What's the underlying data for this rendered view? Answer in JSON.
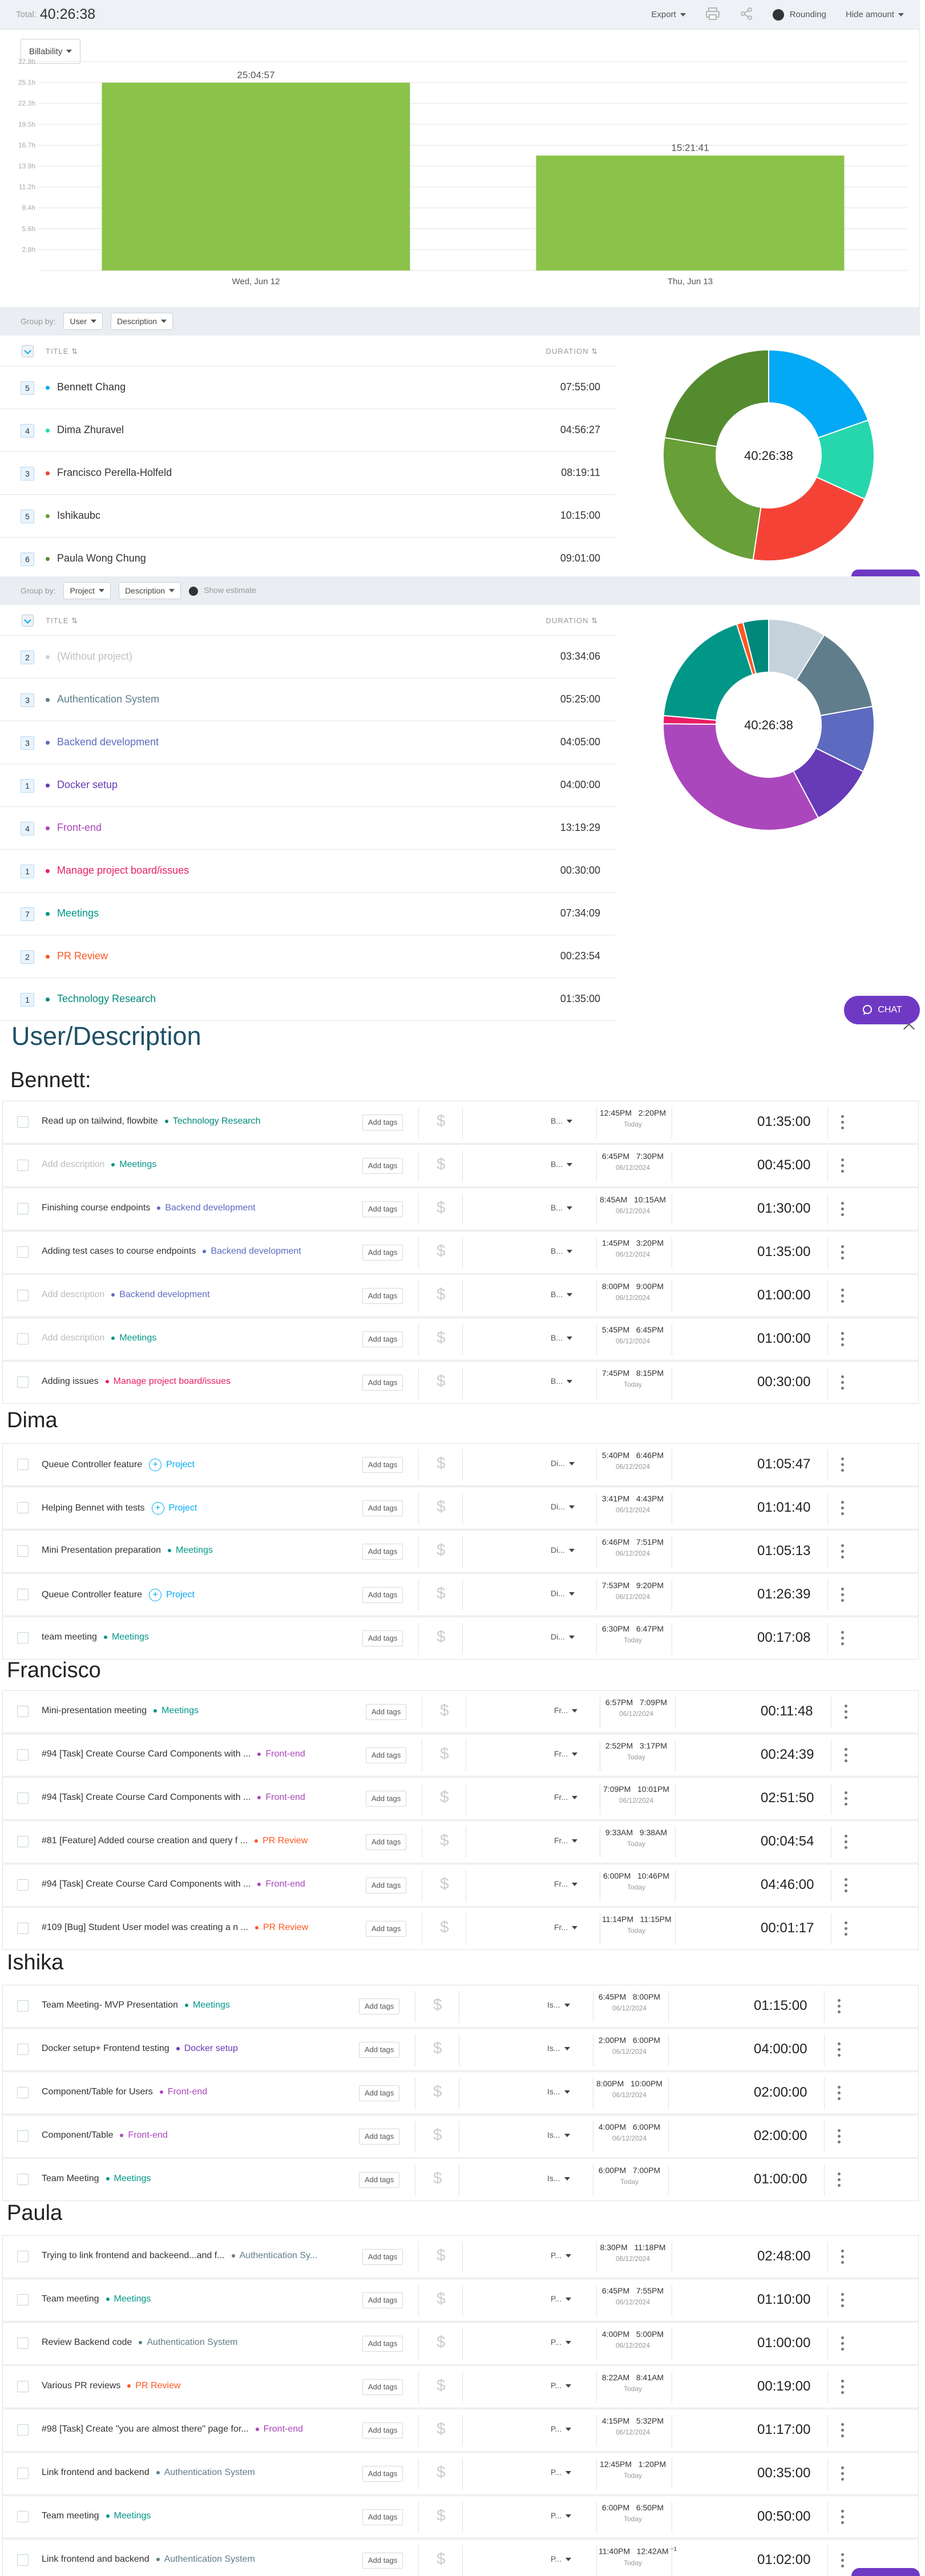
{
  "topbar": {
    "total_label": "Total:",
    "total_value": "40:26:38",
    "export_label": "Export",
    "rounding_label": "Rounding",
    "hide_amount_label": "Hide amount"
  },
  "billability_label": "Billability",
  "chart_data": {
    "type": "bar",
    "categories": [
      "Wed, Jun 12",
      "Thu, Jun 13"
    ],
    "values": [
      25.0825,
      15.3558
    ],
    "data_labels": [
      "25:04:57",
      "15:21:41"
    ],
    "yticks": [
      "27.9h",
      "25.1h",
      "22.3h",
      "19.5h",
      "16.7h",
      "13.9h",
      "11.2h",
      "8.4h",
      "5.6h",
      "2.8h"
    ],
    "ylim": [
      0,
      27.9
    ],
    "grid": true,
    "bar_color": "#8bc34a"
  },
  "groupby1": {
    "label": "Group by:",
    "dd1": "User",
    "dd2": "Description"
  },
  "groupby2": {
    "label": "Group by:",
    "dd1": "Project",
    "dd2": "Description",
    "show_estimate": "Show estimate"
  },
  "table_headers": {
    "title": "TITLE",
    "duration": "DURATION"
  },
  "user_summary": [
    {
      "count": "5",
      "name": "Bennett Chang",
      "duration": "07:55:00",
      "color": "#03a9f4",
      "hours": 7.9167
    },
    {
      "count": "4",
      "name": "Dima Zhuravel",
      "duration": "04:56:27",
      "color": "#26d7ae",
      "hours": 4.9408
    },
    {
      "count": "3",
      "name": "Francisco Perella-Holfeld",
      "duration": "08:19:11",
      "color": "#f44336",
      "hours": 8.3197
    },
    {
      "count": "5",
      "name": "Ishikaubc",
      "duration": "10:15:00",
      "color": "#689f38",
      "hours": 10.25
    },
    {
      "count": "6",
      "name": "Paula Wong Chung",
      "duration": "09:01:00",
      "color": "#558b2f",
      "hours": 9.0167
    }
  ],
  "project_summary": [
    {
      "count": "2",
      "name": "(Without project)",
      "duration": "03:34:06",
      "color": "#c5d2db",
      "hours": 3.5683,
      "muted": true
    },
    {
      "count": "3",
      "name": "Authentication System",
      "duration": "05:25:00",
      "color": "#607d8b",
      "hours": 5.4167
    },
    {
      "count": "3",
      "name": "Backend development",
      "duration": "04:05:00",
      "color": "#5c6bc0",
      "hours": 4.0833
    },
    {
      "count": "1",
      "name": "Docker setup",
      "duration": "04:00:00",
      "color": "#673ab7",
      "hours": 4.0
    },
    {
      "count": "4",
      "name": "Front-end",
      "duration": "13:19:29",
      "color": "#ab47bc",
      "hours": 13.3247
    },
    {
      "count": "1",
      "name": "Manage project board/issues",
      "duration": "00:30:00",
      "color": "#e91e63",
      "hours": 0.5
    },
    {
      "count": "7",
      "name": "Meetings",
      "duration": "07:34:09",
      "color": "#009688",
      "hours": 7.5692
    },
    {
      "count": "2",
      "name": "PR Review",
      "duration": "00:23:54",
      "color": "#ff5722",
      "hours": 0.3983
    },
    {
      "count": "1",
      "name": "Technology Research",
      "duration": "01:35:00",
      "color": "#00897b",
      "hours": 1.5833
    }
  ],
  "pie_center": "40:26:38",
  "chat_label": "CHAT",
  "detail_title": "User/Description",
  "add_tags": "Add tags",
  "groups": [
    {
      "name": "Bennett:",
      "entries": [
        {
          "desc": "Read up on tailwind, flowbite",
          "project": "Technology Research",
          "pcolor": "#00897b",
          "user": "B...",
          "start": "12:45PM",
          "end": "2:20PM",
          "date": "Today",
          "dur": "01:35:00"
        },
        {
          "desc": "Add description",
          "empty": true,
          "project": "Meetings",
          "pcolor": "#009688",
          "user": "B...",
          "start": "6:45PM",
          "end": "7:30PM",
          "date": "06/12/2024",
          "dur": "00:45:00"
        },
        {
          "desc": "Finishing course endpoints",
          "project": "Backend development",
          "pcolor": "#5c6bc0",
          "user": "B...",
          "start": "8:45AM",
          "end": "10:15AM",
          "date": "06/12/2024",
          "dur": "01:30:00"
        },
        {
          "desc": "Adding test cases to course endpoints",
          "project": "Backend development",
          "pcolor": "#5c6bc0",
          "user": "B...",
          "start": "1:45PM",
          "end": "3:20PM",
          "date": "06/12/2024",
          "dur": "01:35:00"
        },
        {
          "desc": "Add description",
          "empty": true,
          "project": "Backend development",
          "pcolor": "#5c6bc0",
          "user": "B...",
          "start": "8:00PM",
          "end": "9:00PM",
          "date": "06/12/2024",
          "dur": "01:00:00"
        },
        {
          "desc": "Add description",
          "empty": true,
          "project": "Meetings",
          "pcolor": "#009688",
          "user": "B...",
          "start": "5:45PM",
          "end": "6:45PM",
          "date": "06/12/2024",
          "dur": "01:00:00"
        },
        {
          "desc": "Adding issues",
          "project": "Manage project board/issues",
          "pcolor": "#e91e63",
          "user": "B...",
          "start": "7:45PM",
          "end": "8:15PM",
          "date": "Today",
          "dur": "00:30:00"
        }
      ]
    },
    {
      "name": "Dima",
      "entries": [
        {
          "desc": "Queue Controller feature",
          "project": "Project",
          "noproj": true,
          "pcolor": "#03a9f4",
          "user": "Di...",
          "start": "5:40PM",
          "end": "6:46PM",
          "date": "06/12/2024",
          "dur": "01:05:47"
        },
        {
          "desc": "Helping Bennet with tests",
          "project": "Project",
          "noproj": true,
          "pcolor": "#03a9f4",
          "user": "Di...",
          "start": "3:41PM",
          "end": "4:43PM",
          "date": "06/12/2024",
          "dur": "01:01:40"
        },
        {
          "desc": "Mini Presentation preparation",
          "project": "Meetings",
          "pcolor": "#009688",
          "user": "Di...",
          "start": "6:46PM",
          "end": "7:51PM",
          "date": "06/12/2024",
          "dur": "01:05:13"
        },
        {
          "desc": "Queue Controller feature",
          "project": "Project",
          "noproj": true,
          "pcolor": "#03a9f4",
          "user": "Di...",
          "start": "7:53PM",
          "end": "9:20PM",
          "date": "06/12/2024",
          "dur": "01:26:39"
        },
        {
          "desc": "team meeting",
          "project": "Meetings",
          "pcolor": "#009688",
          "user": "Di...",
          "start": "6:30PM",
          "end": "6:47PM",
          "date": "Today",
          "dur": "00:17:08"
        }
      ]
    },
    {
      "name": "Francisco",
      "entries": [
        {
          "desc": "Mini-presentation meeting",
          "project": "Meetings",
          "pcolor": "#009688",
          "user": "Fr...",
          "start": "6:57PM",
          "end": "7:09PM",
          "date": "06/12/2024",
          "dur": "00:11:48"
        },
        {
          "desc": "#94 [Task] Create Course Card Components with ...",
          "project": "Front-end",
          "pcolor": "#ab47bc",
          "user": "Fr...",
          "start": "2:52PM",
          "end": "3:17PM",
          "date": "Today",
          "dur": "00:24:39"
        },
        {
          "desc": "#94 [Task] Create Course Card Components with ...",
          "project": "Front-end",
          "pcolor": "#ab47bc",
          "user": "Fr...",
          "start": "7:09PM",
          "end": "10:01PM",
          "date": "06/12/2024",
          "dur": "02:51:50"
        },
        {
          "desc": "#81 [Feature] Added course creation and query f ...",
          "project": "PR Review",
          "pcolor": "#ff5722",
          "user": "Fr...",
          "start": "9:33AM",
          "end": "9:38AM",
          "date": "Today",
          "dur": "00:04:54"
        },
        {
          "desc": "#94 [Task] Create Course Card Components with ...",
          "project": "Front-end",
          "pcolor": "#ab47bc",
          "user": "Fr...",
          "start": "6:00PM",
          "end": "10:46PM",
          "date": "Today",
          "dur": "04:46:00"
        },
        {
          "desc": "#109 [Bug] Student User model was creating a n ...",
          "project": "PR Review",
          "pcolor": "#ff5722",
          "user": "Fr...",
          "start": "11:14PM",
          "end": "11:15PM",
          "date": "Today",
          "dur": "00:01:17"
        }
      ]
    },
    {
      "name": "Ishika",
      "entries": [
        {
          "desc": "Team Meeting- MVP Presentation",
          "project": "Meetings",
          "pcolor": "#009688",
          "user": "Is...",
          "start": "6:45PM",
          "end": "8:00PM",
          "date": "06/12/2024",
          "dur": "01:15:00"
        },
        {
          "desc": "Docker setup+ Frontend testing",
          "project": "Docker setup",
          "pcolor": "#673ab7",
          "user": "Is...",
          "start": "2:00PM",
          "end": "6:00PM",
          "date": "06/12/2024",
          "dur": "04:00:00"
        },
        {
          "desc": "Component/Table for Users",
          "project": "Front-end",
          "pcolor": "#ab47bc",
          "user": "Is...",
          "start": "8:00PM",
          "end": "10:00PM",
          "date": "06/12/2024",
          "dur": "02:00:00"
        },
        {
          "desc": "Component/Table",
          "project": "Front-end",
          "pcolor": "#ab47bc",
          "user": "Is...",
          "start": "4:00PM",
          "end": "6:00PM",
          "date": "06/12/2024",
          "dur": "02:00:00"
        },
        {
          "desc": "Team Meeting",
          "project": "Meetings",
          "pcolor": "#009688",
          "user": "Is...",
          "start": "6:00PM",
          "end": "7:00PM",
          "date": "Today",
          "dur": "01:00:00"
        }
      ]
    },
    {
      "name": "Paula",
      "entries": [
        {
          "desc": "Trying to link frontend and backeend...and f...",
          "project": "Authentication Sy...",
          "pcolor": "#607d8b",
          "user": "P...",
          "start": "8:30PM",
          "end": "11:18PM",
          "date": "06/12/2024",
          "dur": "02:48:00"
        },
        {
          "desc": "Team meeting",
          "project": "Meetings",
          "pcolor": "#009688",
          "user": "P...",
          "start": "6:45PM",
          "end": "7:55PM",
          "date": "06/12/2024",
          "dur": "01:10:00"
        },
        {
          "desc": "Review Backend code",
          "project": "Authentication System",
          "pcolor": "#607d8b",
          "user": "P...",
          "start": "4:00PM",
          "end": "5:00PM",
          "date": "06/12/2024",
          "dur": "01:00:00"
        },
        {
          "desc": "Various PR reviews",
          "project": "PR Review",
          "pcolor": "#ff5722",
          "user": "P...",
          "start": "8:22AM",
          "end": "8:41AM",
          "date": "Today",
          "dur": "00:19:00"
        },
        {
          "desc": "#98 [Task] Create \"you are almost there\" page for...",
          "project": "Front-end",
          "pcolor": "#ab47bc",
          "user": "P...",
          "start": "4:15PM",
          "end": "5:32PM",
          "date": "06/12/2024",
          "dur": "01:17:00"
        },
        {
          "desc": "Link frontend and backend",
          "project": "Authentication System",
          "pcolor": "#607d8b",
          "user": "P...",
          "start": "12:45PM",
          "end": "1:20PM",
          "date": "Today",
          "dur": "00:35:00"
        },
        {
          "desc": "Team meeting",
          "project": "Meetings",
          "pcolor": "#009688",
          "user": "P...",
          "start": "6:00PM",
          "end": "6:50PM",
          "date": "Today",
          "dur": "00:50:00"
        },
        {
          "desc": "Link frontend and backend",
          "project": "Authentication System",
          "pcolor": "#607d8b",
          "user": "P...",
          "start": "11:40PM",
          "end": "12:42AM",
          "sup": "+1",
          "date": "Today",
          "dur": "01:02:00"
        }
      ]
    }
  ]
}
